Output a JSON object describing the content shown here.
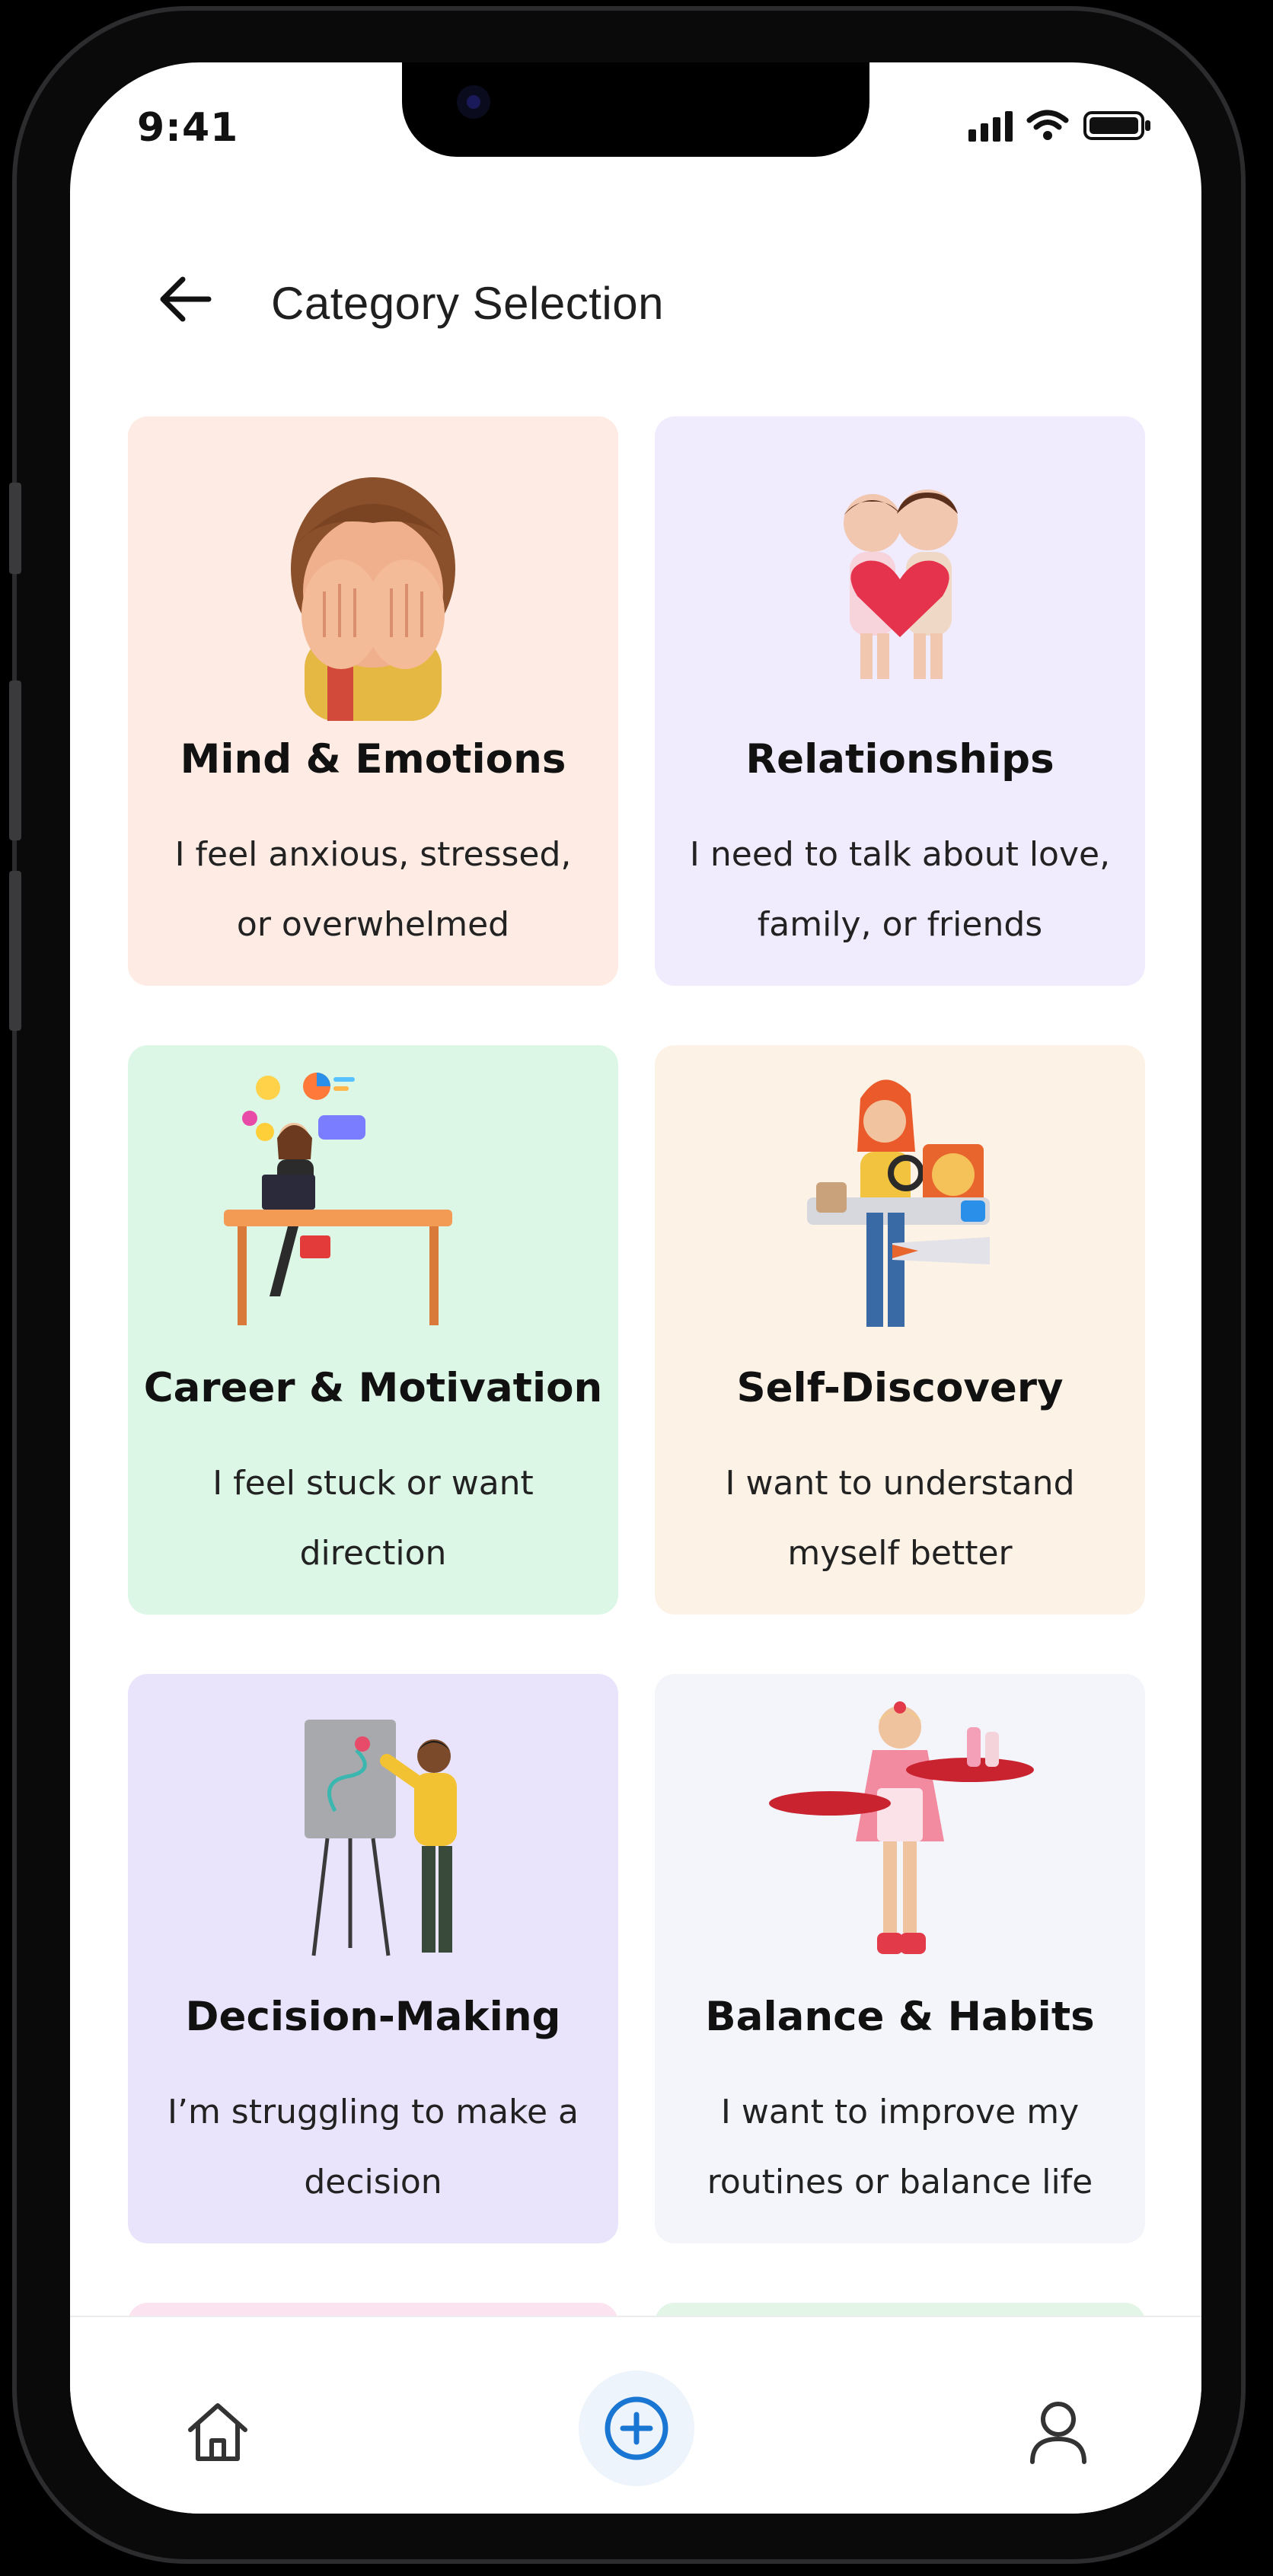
{
  "status_bar": {
    "time": "9:41"
  },
  "header": {
    "title": "Category Selection"
  },
  "categories": [
    {
      "title": "Mind & Emotions",
      "description": "I feel anxious, stressed, or overwhelmed",
      "color": "#fdebe4"
    },
    {
      "title": "Relationships",
      "description": "I need to talk about love, family, or friends",
      "color": "#f1ecfd"
    },
    {
      "title": "Career & Motivation",
      "description": "I feel stuck or want direction",
      "color": "#dcf7e6"
    },
    {
      "title": "Self-Discovery",
      "description": "I want to understand myself better",
      "color": "#fdf2e6"
    },
    {
      "title": "Decision-Making",
      "description": "I’m struggling to make a decision",
      "color": "#e9e4fb"
    },
    {
      "title": "Balance & Habits",
      "description": "I want to improve my routines or balance life",
      "color": "#f4f5fa"
    }
  ],
  "peek_colors": [
    "#fbe3f0",
    "#e3f5e6"
  ],
  "bottom_nav": {
    "items": [
      {
        "icon": "home-icon"
      },
      {
        "icon": "plus-circle-icon"
      },
      {
        "icon": "profile-icon"
      }
    ],
    "accent_color": "#1976d2"
  }
}
